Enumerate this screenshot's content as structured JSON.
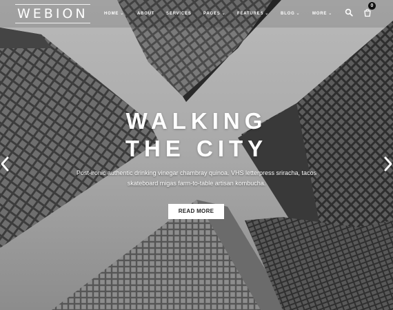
{
  "brand": {
    "logo_text": "WEBION"
  },
  "nav": {
    "items": [
      {
        "label": "HOME",
        "has_dropdown": true
      },
      {
        "label": "ABOUT",
        "has_dropdown": false
      },
      {
        "label": "SERVICES",
        "has_dropdown": false
      },
      {
        "label": "PAGES",
        "has_dropdown": true
      },
      {
        "label": "FEATURES",
        "has_dropdown": true
      },
      {
        "label": "BLOG",
        "has_dropdown": true
      },
      {
        "label": "MORE",
        "has_dropdown": true
      }
    ]
  },
  "header_icons": {
    "search_icon": "search-icon",
    "cart_icon": "shopping-bag-icon",
    "cart_count": "0"
  },
  "slide": {
    "title_line1": "WALKING",
    "title_line2": "THE CITY",
    "subtitle": "Post-ironic authentic drinking vinegar chambray quinoa. VHS letterpress sriracha, tacos skateboard migas farm-to-table artisan kombucha.",
    "button_label": "READ MORE",
    "prev_icon": "chevron-left-icon",
    "next_icon": "chevron-right-icon"
  },
  "colors": {
    "text": "#ffffff",
    "button_bg": "#ffffff",
    "button_text": "#222222"
  }
}
